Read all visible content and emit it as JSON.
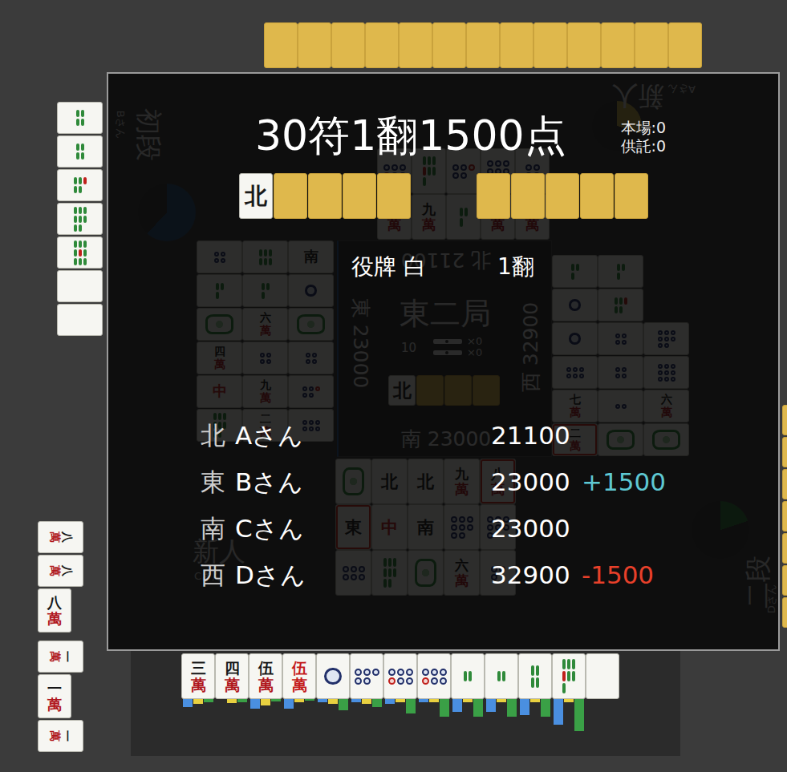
{
  "hands": {
    "top": [
      {
        "kind": "back"
      },
      {
        "kind": "back"
      },
      {
        "kind": "back"
      },
      {
        "kind": "back"
      },
      {
        "kind": "back"
      },
      {
        "kind": "back"
      },
      {
        "kind": "back"
      },
      {
        "kind": "back"
      },
      {
        "kind": "back"
      },
      {
        "kind": "back"
      },
      {
        "kind": "back"
      },
      {
        "kind": "back"
      },
      {
        "kind": "back"
      }
    ],
    "left": [
      {
        "kind": "sou",
        "pips": 4,
        "red": false
      },
      {
        "kind": "sou",
        "pips": 4,
        "red": false
      },
      {
        "kind": "sou",
        "pips": 5,
        "red": true
      },
      {
        "kind": "sou",
        "pips": 8,
        "red": false
      },
      {
        "kind": "sou",
        "pips": 9,
        "red": true
      },
      {
        "kind": "blank"
      },
      {
        "kind": "blank"
      }
    ],
    "melds": [
      [
        {
          "kind": "man",
          "label": "八萬",
          "red": false,
          "sideways": true
        },
        {
          "kind": "man",
          "label": "八萬",
          "red": false,
          "sideways": true
        },
        {
          "kind": "man",
          "label": "八萬",
          "red": false,
          "sideways": false
        }
      ],
      [
        {
          "kind": "man",
          "label": "一萬",
          "red": false,
          "sideways": true
        },
        {
          "kind": "man",
          "label": "一萬",
          "red": false,
          "sideways": false
        },
        {
          "kind": "man",
          "label": "一萬",
          "red": false,
          "sideways": true
        }
      ]
    ],
    "right": [
      {
        "kind": "back"
      },
      {
        "kind": "back"
      },
      {
        "kind": "back"
      },
      {
        "kind": "back"
      },
      {
        "kind": "back"
      },
      {
        "kind": "back"
      },
      {
        "kind": "back"
      }
    ],
    "bottom": [
      {
        "kind": "man",
        "label": "三萬",
        "red": false,
        "bars": [
          0.25,
          0.15,
          0.1
        ]
      },
      {
        "kind": "man",
        "label": "四萬",
        "red": false,
        "bars": [
          0,
          0.12,
          0.1
        ]
      },
      {
        "kind": "man",
        "label": "伍萬",
        "red": false,
        "bars": [
          0.3,
          0.2,
          0.08
        ]
      },
      {
        "kind": "man",
        "label": "伍萬",
        "red": true,
        "bars": [
          0.3,
          0.1,
          0.05
        ]
      },
      {
        "kind": "pin",
        "pips": 1,
        "red": false,
        "bars": [
          0.1,
          0.15,
          0.35
        ]
      },
      {
        "kind": "pin",
        "pips": 5,
        "red": false,
        "bars": [
          0.1,
          0.15,
          0.25
        ]
      },
      {
        "kind": "pin",
        "pips": 6,
        "red": true,
        "bars": [
          0.15,
          0.1,
          0.45
        ]
      },
      {
        "kind": "pin",
        "pips": 6,
        "red": true,
        "bars": [
          0.1,
          0.1,
          0.55
        ]
      },
      {
        "kind": "sou",
        "pips": 2,
        "red": false,
        "bars": [
          0.4,
          0.1,
          0.55
        ]
      },
      {
        "kind": "sou",
        "pips": 2,
        "red": false,
        "bars": [
          0.4,
          0.1,
          0.55
        ]
      },
      {
        "kind": "sou",
        "pips": 4,
        "red": false,
        "bars": [
          0.5,
          0.1,
          0.55
        ]
      },
      {
        "kind": "sou",
        "pips": 7,
        "red": true,
        "bars": [
          0.8,
          0.1,
          1
        ]
      },
      {
        "kind": "blank",
        "bars": [
          0,
          0,
          0
        ]
      }
    ]
  },
  "ponds": {
    "top": [
      [
        {
          "kind": "pin",
          "pips": 6,
          "red": true,
          "highlight": false
        },
        {
          "kind": "sou",
          "pips": 7,
          "red": true,
          "highlight": false
        },
        {
          "kind": "pin",
          "pips": 5,
          "red": true,
          "highlight": false
        },
        {
          "kind": "pin",
          "pips": 7,
          "red": false,
          "highlight": false
        },
        {
          "kind": "pin",
          "pips": 4,
          "red": false,
          "highlight": false
        }
      ],
      [
        {
          "kind": "man",
          "label": "七萬",
          "red": false,
          "highlight": false
        },
        {
          "kind": "man",
          "label": "九萬",
          "red": false,
          "highlight": false
        },
        {
          "kind": "sou",
          "pips": 3,
          "red": false,
          "highlight": false
        },
        {
          "kind": "man",
          "label": "一萬",
          "red": false,
          "highlight": false
        },
        {
          "kind": "man",
          "label": "二萬",
          "red": false,
          "highlight": false
        }
      ]
    ],
    "left": [
      [
        {
          "kind": "pin",
          "pips": 4,
          "red": false,
          "highlight": false
        },
        {
          "kind": "sou",
          "pips": 6,
          "red": false,
          "highlight": false
        },
        {
          "kind": "honor",
          "label": "南",
          "color": "#1a1a1a",
          "highlight": false
        }
      ],
      [
        {
          "kind": "sou",
          "pips": 3,
          "red": false,
          "highlight": false
        },
        {
          "kind": "sou",
          "pips": 3,
          "red": false,
          "highlight": false
        },
        {
          "kind": "pin",
          "pips": 1,
          "red": false,
          "highlight": false
        }
      ],
      [
        {
          "kind": "hatsu",
          "highlight": false
        },
        {
          "kind": "man",
          "label": "六萬",
          "red": false,
          "highlight": false
        },
        {
          "kind": "hatsu",
          "highlight": false
        }
      ],
      [
        {
          "kind": "man",
          "label": "四萬",
          "red": false,
          "highlight": false
        },
        {
          "kind": "pin",
          "pips": 4,
          "red": false,
          "highlight": false
        },
        {
          "kind": "pin",
          "pips": 4,
          "red": false,
          "highlight": false
        }
      ],
      [
        {
          "kind": "honor",
          "label": "中",
          "color": "#c42020",
          "highlight": false
        },
        {
          "kind": "man",
          "label": "九萬",
          "red": false,
          "highlight": false
        },
        {
          "kind": "pin",
          "pips": 5,
          "red": true,
          "highlight": false
        }
      ],
      [
        {
          "kind": "sou",
          "pips": 8,
          "red": false,
          "highlight": false
        },
        {
          "kind": "man",
          "label": "二萬",
          "red": false,
          "highlight": false
        },
        {
          "kind": "pin",
          "pips": 6,
          "red": false,
          "highlight": false
        }
      ]
    ],
    "right": [
      [
        {
          "kind": "sou",
          "pips": 3,
          "red": false,
          "highlight": false
        },
        {
          "kind": "sou",
          "pips": 3,
          "red": false,
          "highlight": false
        },
        {
          "kind": "none"
        }
      ],
      [
        {
          "kind": "pin",
          "pips": 1,
          "red": false,
          "highlight": false
        },
        {
          "kind": "sou",
          "pips": 5,
          "red": true,
          "highlight": false
        },
        {
          "kind": "none"
        }
      ],
      [
        {
          "kind": "pin",
          "pips": 1,
          "red": false,
          "highlight": false
        },
        {
          "kind": "pin",
          "pips": 4,
          "red": false,
          "highlight": false
        },
        {
          "kind": "pin",
          "pips": 8,
          "red": false,
          "highlight": false
        }
      ],
      [
        {
          "kind": "pin",
          "pips": 6,
          "red": false,
          "highlight": false
        },
        {
          "kind": "pin",
          "pips": 4,
          "red": false,
          "highlight": false
        },
        {
          "kind": "pin",
          "pips": 9,
          "red": false,
          "highlight": false
        }
      ],
      [
        {
          "kind": "man",
          "label": "七萬",
          "red": false,
          "highlight": false
        },
        {
          "kind": "pin",
          "pips": 2,
          "red": false,
          "highlight": false
        },
        {
          "kind": "man",
          "label": "六萬",
          "red": false,
          "highlight": false
        }
      ],
      [
        {
          "kind": "man",
          "label": "二萬",
          "red": false,
          "highlight": true
        },
        {
          "kind": "hatsu",
          "highlight": false
        },
        {
          "kind": "hatsu",
          "highlight": false
        }
      ]
    ],
    "bottom": [
      [
        {
          "kind": "hatsu",
          "highlight": false
        },
        {
          "kind": "honor",
          "label": "北",
          "color": "#1a1a1a",
          "highlight": false
        },
        {
          "kind": "honor",
          "label": "北",
          "color": "#1a1a1a",
          "highlight": false
        },
        {
          "kind": "man",
          "label": "九萬",
          "red": false,
          "highlight": false
        },
        {
          "kind": "man",
          "label": "八萬",
          "red": false,
          "highlight": true
        }
      ],
      [
        {
          "kind": "honor",
          "label": "東",
          "color": "#1a1a1a",
          "highlight": true
        },
        {
          "kind": "honor",
          "label": "中",
          "color": "#c42020",
          "highlight": false
        },
        {
          "kind": "honor",
          "label": "南",
          "color": "#1a1a1a",
          "highlight": false
        },
        {
          "kind": "pin",
          "pips": 8,
          "red": false,
          "highlight": false
        },
        {
          "kind": "pin",
          "pips": 7,
          "red": false,
          "highlight": false
        }
      ],
      [
        {
          "kind": "pin",
          "pips": 6,
          "red": false,
          "highlight": false
        },
        {
          "kind": "sou",
          "pips": 8,
          "red": false,
          "highlight": false
        },
        {
          "kind": "hatsu",
          "highlight": false
        },
        {
          "kind": "man",
          "label": "六萬",
          "red": false,
          "highlight": false
        },
        {
          "kind": "pin",
          "pips": 3,
          "red": false,
          "highlight": false
        }
      ]
    ]
  },
  "center": {
    "round": "東二局",
    "remaining": "10",
    "sticks": [
      "×0",
      "×0"
    ],
    "seats": [
      {
        "wind": "北",
        "points": "21100"
      },
      {
        "wind": "東",
        "points": "23000"
      },
      {
        "wind": "西",
        "points": "32900"
      },
      {
        "wind": "南",
        "points": "23000"
      }
    ],
    "dora": [
      {
        "kind": "honor",
        "label": "北",
        "color": "#1a1a1a"
      },
      {
        "kind": "back"
      },
      {
        "kind": "back"
      },
      {
        "kind": "back"
      }
    ]
  },
  "plates": [
    {
      "rank": "初段",
      "player": "Bさん",
      "timer": 0.62,
      "color": "#28507c"
    },
    {
      "rank": "新人",
      "player": "Aさん",
      "timer": 0.3,
      "color": "#c8b048"
    },
    {
      "rank": "新人",
      "player": "Cさん"
    },
    {
      "rank": "二段",
      "player": "Dさん",
      "timer": 0.2,
      "color": "#2e7a3a"
    }
  ],
  "result": {
    "title": "30符1翻1500点",
    "honba": "本場:0",
    "kyotaku": "供託:0",
    "dora": [
      {
        "kind": "honor",
        "label": "北",
        "color": "#1a1a1a"
      },
      {
        "kind": "back"
      },
      {
        "kind": "back"
      },
      {
        "kind": "back"
      },
      {
        "kind": "back"
      }
    ],
    "uradora": [
      {
        "kind": "back"
      },
      {
        "kind": "back"
      },
      {
        "kind": "back"
      },
      {
        "kind": "back"
      },
      {
        "kind": "back"
      }
    ],
    "yaku": [
      {
        "name": "役牌 白",
        "han": "1翻"
      }
    ],
    "scores": [
      {
        "seat": "北",
        "player": "Aさん",
        "points": "21100"
      },
      {
        "seat": "東",
        "player": "Bさん",
        "points": "23000",
        "delta": "+1500",
        "sign": "plus"
      },
      {
        "seat": "南",
        "player": "Cさん",
        "points": "23000"
      },
      {
        "seat": "西",
        "player": "Dさん",
        "points": "32900",
        "delta": "-1500",
        "sign": "minus"
      }
    ]
  }
}
